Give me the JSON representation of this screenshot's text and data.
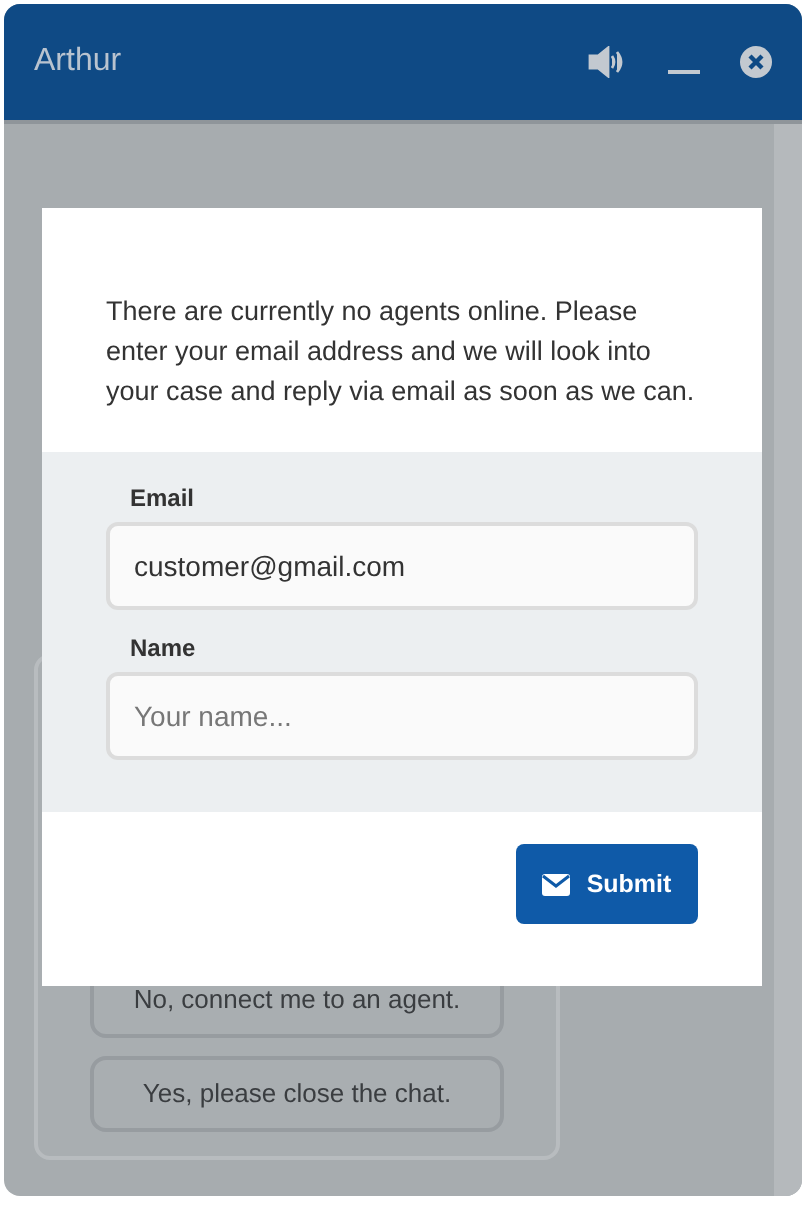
{
  "window": {
    "title": "Arthur"
  },
  "background_chat": {
    "quick_replies": [
      "No, connect me to an agent.",
      "Yes, please close the chat."
    ]
  },
  "dialog": {
    "message": "There are currently no agents online. Please enter your email address and we will look into your case and reply via email as soon as we can.",
    "fields": [
      {
        "label": "Email",
        "value": "customer@gmail.com"
      },
      {
        "label": "Name",
        "placeholder": "Your name..."
      }
    ],
    "submit": "Submit"
  }
}
